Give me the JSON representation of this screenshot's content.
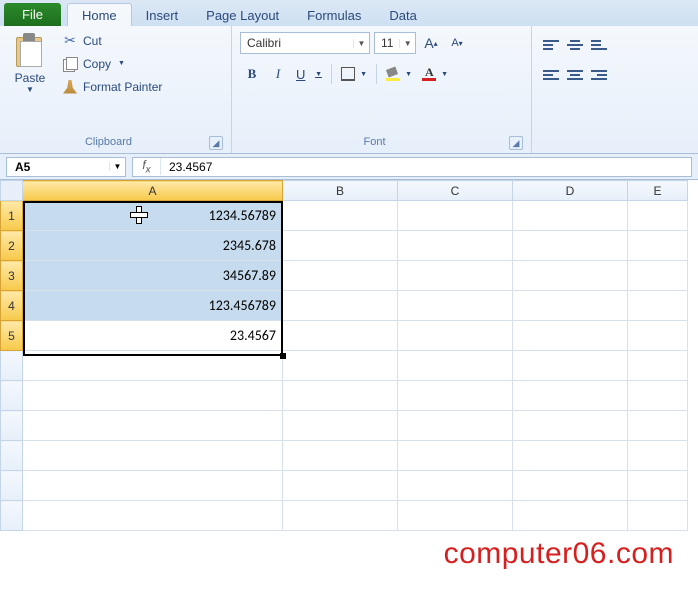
{
  "tabs": {
    "file": "File",
    "home": "Home",
    "insert": "Insert",
    "page_layout": "Page Layout",
    "formulas": "Formulas",
    "data": "Data"
  },
  "clipboard": {
    "group_label": "Clipboard",
    "paste": "Paste",
    "cut": "Cut",
    "copy": "Copy",
    "format_painter": "Format Painter"
  },
  "font": {
    "group_label": "Font",
    "name": "Calibri",
    "size": "11",
    "bold": "B",
    "italic": "I",
    "underline": "U",
    "grow": "A",
    "shrink": "A"
  },
  "namebox": "A5",
  "formula_value": "23.4567",
  "columns": [
    "A",
    "B",
    "C",
    "D",
    "E"
  ],
  "rows": [
    "1",
    "2",
    "3",
    "4",
    "5"
  ],
  "cells": {
    "A1": "1234.56789",
    "A2": "2345.678",
    "A3": "34567.89",
    "A4": "123.456789",
    "A5": "23.4567"
  },
  "selection": {
    "range": "A1:A5",
    "active": "A5"
  },
  "watermark": "computer06.com"
}
